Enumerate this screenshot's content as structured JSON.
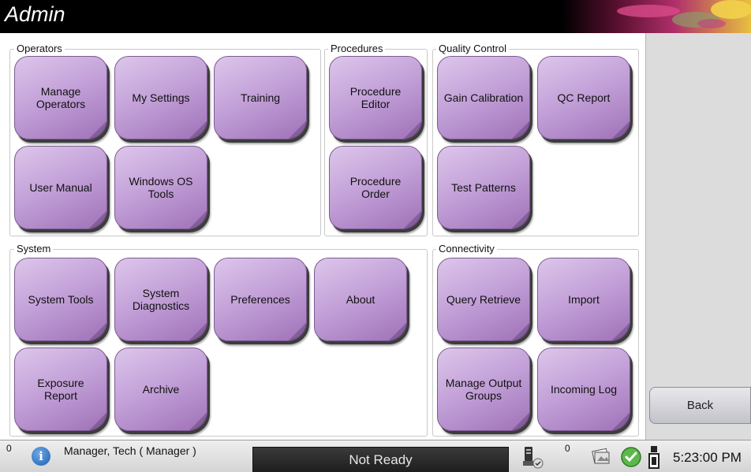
{
  "window": {
    "title": "Admin"
  },
  "groups": {
    "operators": "Operators",
    "procedures": "Procedures",
    "quality_control": "Quality Control",
    "system": "System",
    "connectivity": "Connectivity"
  },
  "buttons": {
    "manage_operators": "Manage\nOperators",
    "my_settings": "My Settings",
    "training": "Training",
    "user_manual": "User Manual",
    "windows_os_tools": "Windows OS\nTools",
    "procedure_editor": "Procedure\nEditor",
    "procedure_order": "Procedure\nOrder",
    "gain_calibration": "Gain Calibration",
    "qc_report": "QC Report",
    "test_patterns": "Test Patterns",
    "system_tools": "System Tools",
    "system_diagnostics": "System\nDiagnostics",
    "preferences": "Preferences",
    "about": "About",
    "exposure_report": "Exposure\nReport",
    "archive": "Archive",
    "query_retrieve": "Query Retrieve",
    "import": "Import",
    "manage_output_groups": "Manage Output\nGroups",
    "incoming_log": "Incoming Log",
    "back": "Back"
  },
  "statusbar": {
    "alarm_count": "0",
    "user": "Manager, Tech ( Manager )",
    "status": "Not Ready",
    "queue_count": "0",
    "time": "5:23:00 PM",
    "icons": [
      "info-icon",
      "output-device-icon",
      "film-queue-icon",
      "check-ok-icon",
      "detector-status-icon"
    ]
  },
  "colors": {
    "button_purple": "#c4a2d9",
    "status_bg": "#1e1e1e",
    "title_bg": "#000000"
  }
}
